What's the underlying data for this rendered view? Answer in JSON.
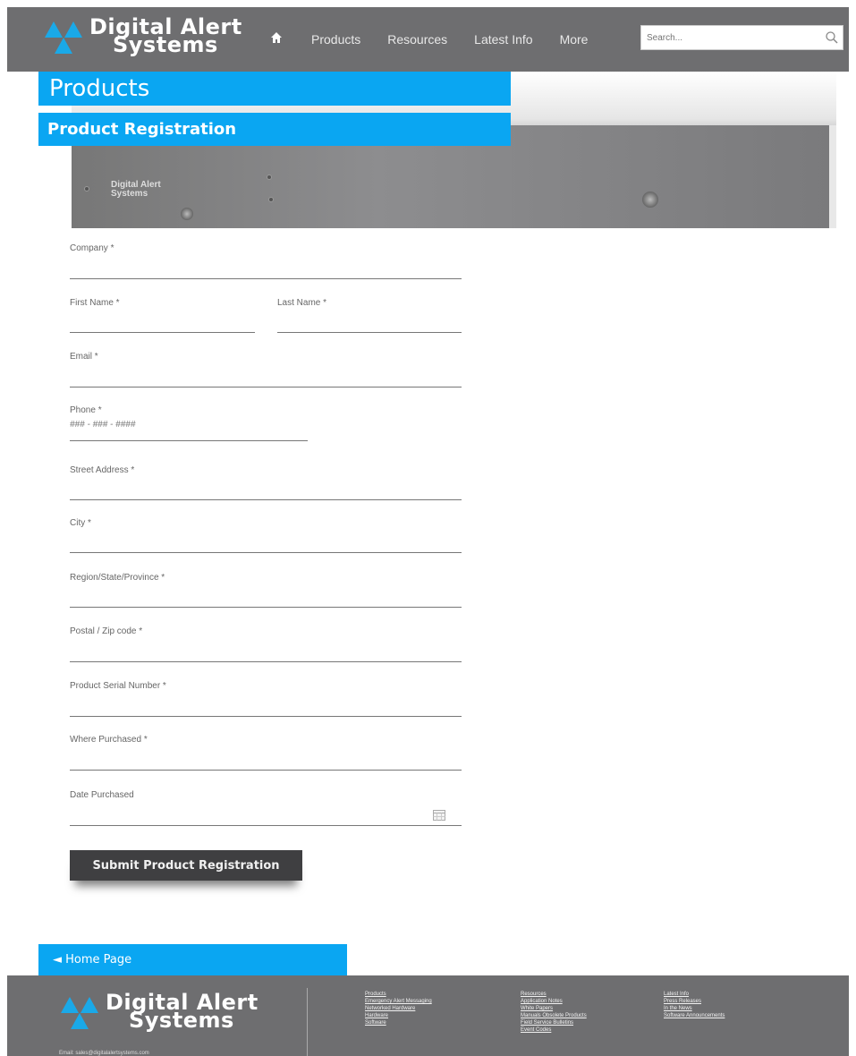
{
  "header": {
    "logo_line1": "Digital Alert",
    "logo_line2": "Systems",
    "nav": [
      "Products",
      "Resources",
      "Latest Info",
      "More"
    ],
    "search_placeholder": "Search..."
  },
  "banners": {
    "products": "Products",
    "registration": "Product Registration"
  },
  "hero": {
    "brand_line1": "Digital Alert",
    "brand_line2": "Systems"
  },
  "form": {
    "company": "Company *",
    "first_name": "First Name *",
    "last_name": "Last Name *",
    "email": "Email *",
    "phone": "Phone *",
    "phone_placeholder": "### - ### - ####",
    "street": "Street Address *",
    "city": "City *",
    "region": "Region/State/Province *",
    "postal": "Postal / Zip code *",
    "serial": "Product Serial Number *",
    "where": "Where Purchased *",
    "date": "Date Purchased",
    "submit": "Submit Product Registration"
  },
  "home_link": "◄ Home Page",
  "footer": {
    "logo_line1": "Digital Alert",
    "logo_line2": "Systems",
    "email": "Email: sales@digitalalertsystems.com",
    "col1": [
      "Products",
      "Emergency Alert Messaging",
      "Networked Hardware",
      "Hardware",
      "Software"
    ],
    "col2": [
      "Resources",
      "Application Notes",
      "White Papers",
      "Manuals Obsolete Products",
      "Field Service Bulletins",
      "Event Codes"
    ],
    "col3": [
      "Latest Info",
      "Press Releases",
      "In the News",
      "Software Announcements"
    ]
  },
  "colors": {
    "accent": "#0aa6f2",
    "header_bg": "#6e6e70",
    "button_bg": "#3f3f41"
  }
}
